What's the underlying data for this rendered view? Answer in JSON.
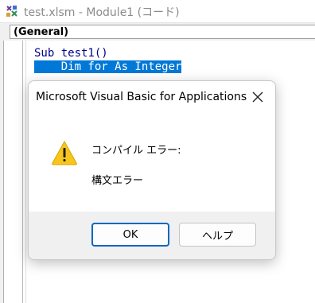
{
  "window": {
    "title": "test.xlsm - Module1 (コード)"
  },
  "procedure_combo": {
    "value": "(General)"
  },
  "code": {
    "line1": "Sub test1()",
    "line2_highlight": "    Dim for As Integer"
  },
  "dialog": {
    "title": "Microsoft Visual Basic for Applications",
    "message_heading": "コンパイル エラー:",
    "message_detail": "構文エラー",
    "ok_label": "OK",
    "help_label": "ヘルプ"
  },
  "icons": {
    "app": "vbe-module-icon",
    "warning": "warning-icon",
    "close": "close-icon"
  },
  "colors": {
    "selection": "#0078d7",
    "code_text": "#00008b",
    "warning_fill": "#f7c51b",
    "default_button_border": "#0067c0"
  }
}
